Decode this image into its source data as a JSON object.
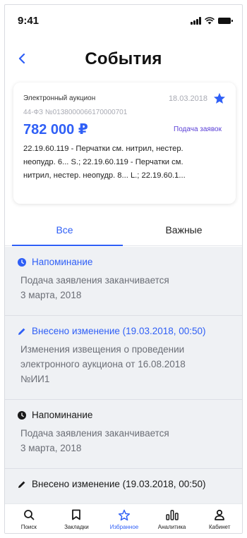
{
  "status_bar": {
    "time": "9:41"
  },
  "header": {
    "title": "События"
  },
  "card": {
    "type": "Электронный аукцион",
    "date": "18.03.2018",
    "number": "44-ФЗ  №0138000066170000701",
    "price": "782 000 ₽",
    "status": "Подача заявок",
    "description_lines": [
      "22.19.60.119 - Перчатки см. нитрил, нестер.",
      "неопудр. 6... S.; 22.19.60.119 - Перчатки см.",
      "нитрил, нестер. неопудр. 8... L.; 22.19.60.1..."
    ]
  },
  "tabs": [
    {
      "label": "Все",
      "active": true
    },
    {
      "label": "Важные",
      "active": false
    }
  ],
  "events": [
    {
      "icon": "clock-icon",
      "highlight": true,
      "title": "Напоминание",
      "body": [
        "Подача заявления заканчивается",
        "3 марта, 2018"
      ]
    },
    {
      "icon": "pencil-icon",
      "highlight": true,
      "title": "Внесено изменение (19.03.2018, 00:50)",
      "body": [
        "Изменения извещения о проведении",
        "электронного аукциона от 16.08.2018",
        "№ИИ1"
      ]
    },
    {
      "icon": "clock-icon",
      "highlight": false,
      "title": "Напоминание",
      "body": [
        "Подача заявления заканчивается",
        "3 марта, 2018"
      ]
    },
    {
      "icon": "pencil-icon",
      "highlight": false,
      "title": "Внесено изменение (19.03.2018, 00:50)",
      "body": []
    }
  ],
  "bottom_nav": [
    {
      "label": "Поиск",
      "icon": "search-icon",
      "active": false
    },
    {
      "label": "Закладки",
      "icon": "bookmark-icon",
      "active": false
    },
    {
      "label": "Избранное",
      "icon": "star-icon",
      "active": true
    },
    {
      "label": "Аналитика",
      "icon": "analytics-icon",
      "active": false
    },
    {
      "label": "Кабинет",
      "icon": "user-icon",
      "active": false
    }
  ],
  "colors": {
    "accent": "#2f5ff6",
    "status": "#5a3fd6",
    "feed_bg": "#eff1f4"
  }
}
